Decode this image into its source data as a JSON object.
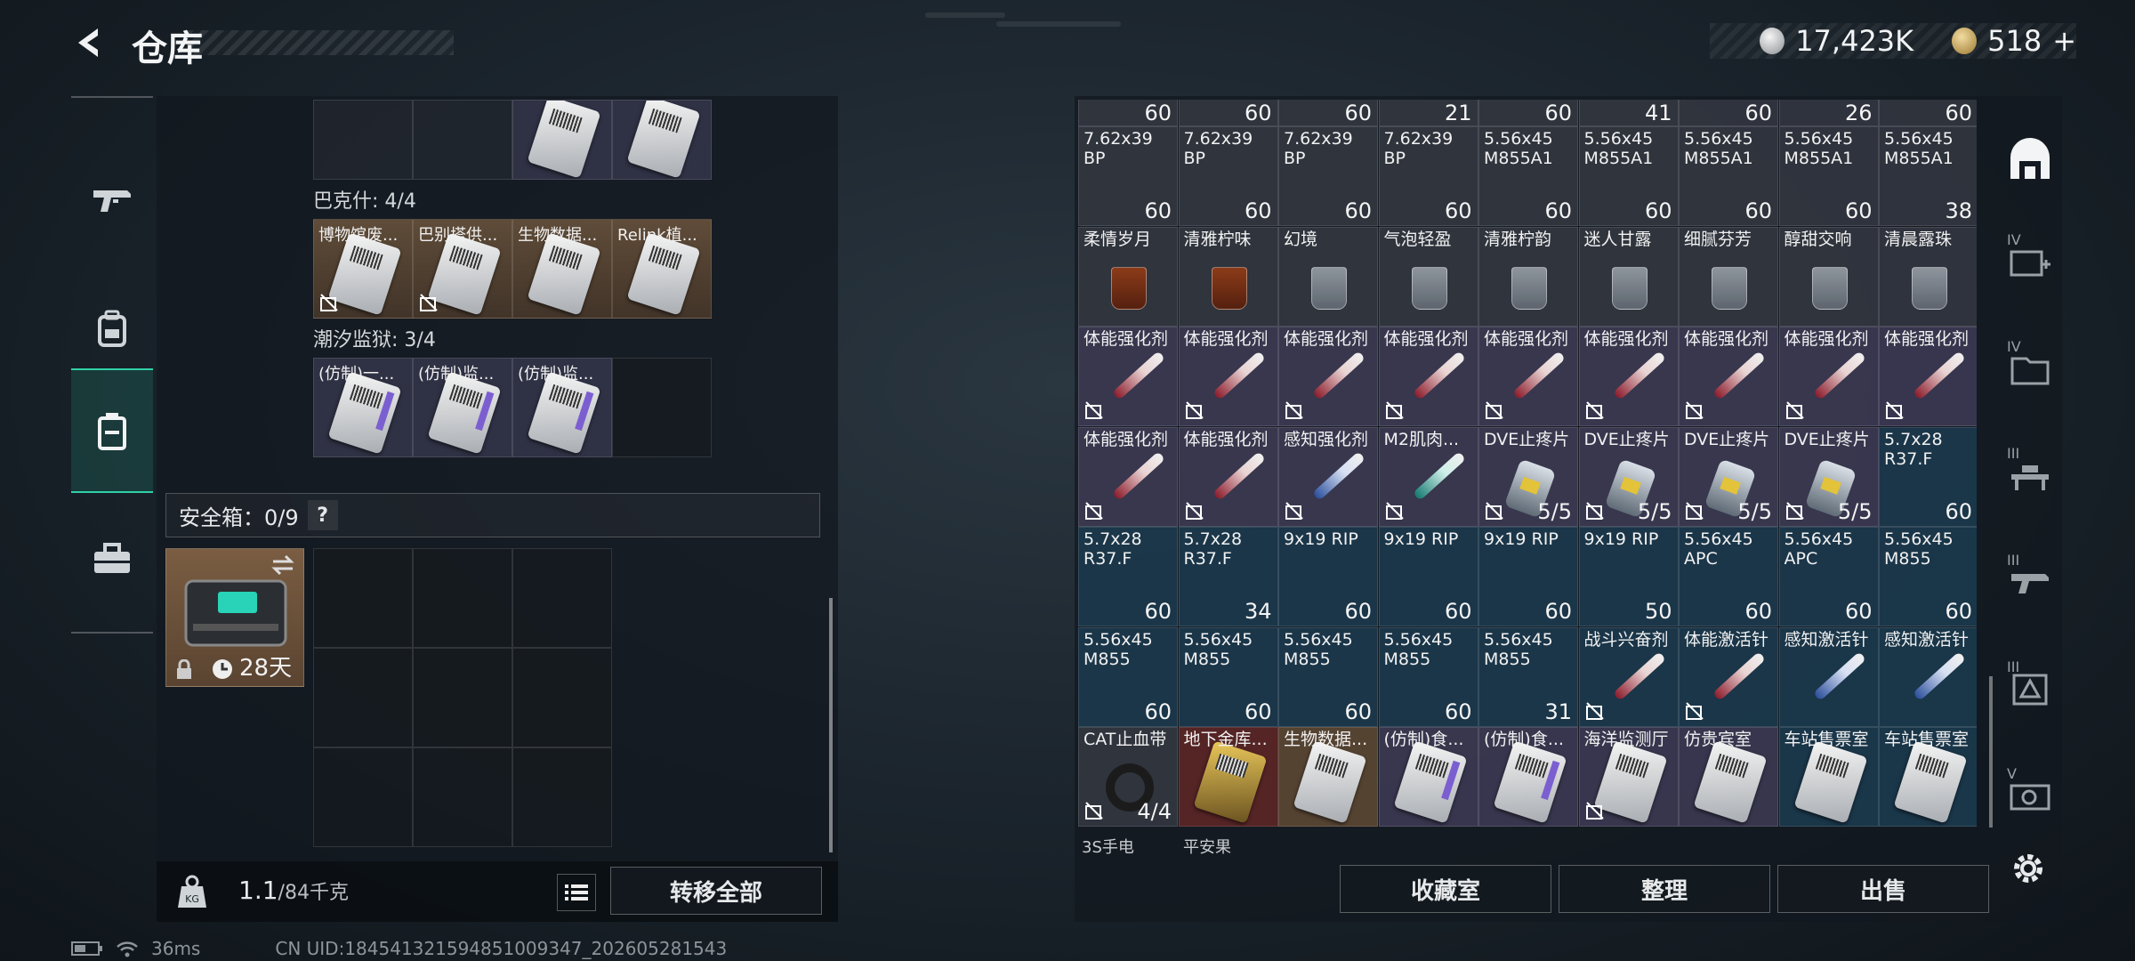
{
  "header": {
    "title": "仓库"
  },
  "currency": [
    {
      "icon": "silver-coin-icon",
      "value": "17,423K"
    },
    {
      "icon": "gold-coin-icon",
      "value": "518",
      "add": "+"
    }
  ],
  "left_nav": [
    {
      "icon": "gun-icon"
    },
    {
      "icon": "backpack-icon"
    },
    {
      "icon": "container-icon",
      "active": true
    },
    {
      "icon": "toolbox-icon"
    }
  ],
  "sections": [
    {
      "label": "巴克什: 4/4",
      "items": [
        "博物馆废...",
        "巴别塔供...",
        "生物数据...",
        "Relink植..."
      ]
    },
    {
      "label": "潮汐监狱: 3/4",
      "items": [
        "(仿制)一...",
        "(仿制)监...",
        "(仿制)监...",
        ""
      ]
    }
  ],
  "safe_box": {
    "label": "安全箱：0/9",
    "help": "?",
    "timer": "28天"
  },
  "weight": {
    "current": "1.1",
    "max": "/84千克"
  },
  "buttons": {
    "transfer_all": "转移全部",
    "collection": "收藏室",
    "organize": "整理",
    "sell": "出售"
  },
  "top_counts": [
    "60",
    "60",
    "60",
    "21",
    "60",
    "41",
    "60",
    "26",
    "60"
  ],
  "inventory_rows": [
    [
      {
        "name": "7.62x39 BP",
        "count": "60",
        "kind": "ammo-tan",
        "bg": "bg-gray"
      },
      {
        "name": "7.62x39 BP",
        "count": "60",
        "kind": "ammo-tan",
        "bg": "bg-gray"
      },
      {
        "name": "7.62x39 BP",
        "count": "60",
        "kind": "ammo-tan",
        "bg": "bg-gray"
      },
      {
        "name": "7.62x39 BP",
        "count": "60",
        "kind": "ammo-tan",
        "bg": "bg-gray"
      },
      {
        "name": "5.56x45 M855A1",
        "count": "60",
        "kind": "ammo-red",
        "bg": "bg-gray"
      },
      {
        "name": "5.56x45 M855A1",
        "count": "60",
        "kind": "ammo-red",
        "bg": "bg-gray"
      },
      {
        "name": "5.56x45 M855A1",
        "count": "60",
        "kind": "ammo-red",
        "bg": "bg-gray"
      },
      {
        "name": "5.56x45 M855A1",
        "count": "60",
        "kind": "ammo-red",
        "bg": "bg-gray"
      },
      {
        "name": "5.56x45 M855A1",
        "count": "38",
        "kind": "ammo-red",
        "bg": "bg-gray"
      }
    ],
    [
      {
        "name": "柔情岁月",
        "count": "",
        "kind": "glass amber",
        "bg": "bg-gray"
      },
      {
        "name": "清雅柠味",
        "count": "",
        "kind": "glass amber",
        "bg": "bg-gray"
      },
      {
        "name": "幻境",
        "count": "",
        "kind": "glass",
        "bg": "bg-gray"
      },
      {
        "name": "气泡轻盈",
        "count": "",
        "kind": "glass",
        "bg": "bg-gray"
      },
      {
        "name": "清雅柠韵",
        "count": "",
        "kind": "glass",
        "bg": "bg-gray"
      },
      {
        "name": "迷人甘露",
        "count": "",
        "kind": "glass",
        "bg": "bg-gray"
      },
      {
        "name": "细腻芬芳",
        "count": "",
        "kind": "glass",
        "bg": "bg-gray"
      },
      {
        "name": "醇甜交响",
        "count": "",
        "kind": "glass",
        "bg": "bg-gray"
      },
      {
        "name": "清晨露珠",
        "count": "",
        "kind": "glass",
        "bg": "bg-gray"
      }
    ],
    [
      {
        "name": "体能强化剂",
        "count": "",
        "kind": "syringe syr-red",
        "bg": "bg-purple",
        "lock": true
      },
      {
        "name": "体能强化剂",
        "count": "",
        "kind": "syringe syr-red",
        "bg": "bg-purple",
        "lock": true
      },
      {
        "name": "体能强化剂",
        "count": "",
        "kind": "syringe syr-red",
        "bg": "bg-purple",
        "lock": true
      },
      {
        "name": "体能强化剂",
        "count": "",
        "kind": "syringe syr-red",
        "bg": "bg-purple",
        "lock": true
      },
      {
        "name": "体能强化剂",
        "count": "",
        "kind": "syringe syr-red",
        "bg": "bg-purple",
        "lock": true
      },
      {
        "name": "体能强化剂",
        "count": "",
        "kind": "syringe syr-red",
        "bg": "bg-purple",
        "lock": true
      },
      {
        "name": "体能强化剂",
        "count": "",
        "kind": "syringe syr-red",
        "bg": "bg-purple",
        "lock": true
      },
      {
        "name": "体能强化剂",
        "count": "",
        "kind": "syringe syr-red",
        "bg": "bg-purple",
        "lock": true
      },
      {
        "name": "体能强化剂",
        "count": "",
        "kind": "syringe syr-red",
        "bg": "bg-purple",
        "lock": true
      }
    ],
    [
      {
        "name": "体能强化剂",
        "count": "",
        "kind": "syringe syr-red",
        "bg": "bg-purple",
        "lock": true
      },
      {
        "name": "体能强化剂",
        "count": "",
        "kind": "syringe syr-red",
        "bg": "bg-purple",
        "lock": true
      },
      {
        "name": "感知强化剂",
        "count": "",
        "kind": "syringe syr-blue",
        "bg": "bg-purple",
        "lock": true
      },
      {
        "name": "M2肌肉...",
        "count": "",
        "kind": "syringe syr-teal",
        "bg": "bg-purple",
        "lock": true
      },
      {
        "name": "DVE止疼片",
        "count": "5/5",
        "kind": "pill",
        "bg": "bg-purple",
        "lock": true
      },
      {
        "name": "DVE止疼片",
        "count": "5/5",
        "kind": "pill",
        "bg": "bg-purple",
        "lock": true
      },
      {
        "name": "DVE止疼片",
        "count": "5/5",
        "kind": "pill",
        "bg": "bg-purple",
        "lock": true
      },
      {
        "name": "DVE止疼片",
        "count": "5/5",
        "kind": "pill",
        "bg": "bg-purple",
        "lock": true
      },
      {
        "name": "5.7x28 R37.F",
        "count": "60",
        "kind": "ammo-tan",
        "bg": "bg-blue"
      }
    ],
    [
      {
        "name": "5.7x28 R37.F",
        "count": "60",
        "kind": "ammo-tan",
        "bg": "bg-blue"
      },
      {
        "name": "5.7x28 R37.F",
        "count": "34",
        "kind": "ammo-tan",
        "bg": "bg-blue"
      },
      {
        "name": "9x19 RIP",
        "count": "60",
        "kind": "ammo-green",
        "bg": "bg-blue"
      },
      {
        "name": "9x19 RIP",
        "count": "60",
        "kind": "ammo-green",
        "bg": "bg-blue"
      },
      {
        "name": "9x19 RIP",
        "count": "60",
        "kind": "ammo-green",
        "bg": "bg-blue"
      },
      {
        "name": "9x19 RIP",
        "count": "50",
        "kind": "ammo-green",
        "bg": "bg-blue"
      },
      {
        "name": "5.56x45 APC",
        "count": "60",
        "kind": "ammo-red",
        "bg": "bg-blue"
      },
      {
        "name": "5.56x45 APC",
        "count": "60",
        "kind": "ammo-red",
        "bg": "bg-blue"
      },
      {
        "name": "5.56x45 M855",
        "count": "60",
        "kind": "ammo-red",
        "bg": "bg-blue"
      }
    ],
    [
      {
        "name": "5.56x45 M855",
        "count": "60",
        "kind": "ammo-red",
        "bg": "bg-blue"
      },
      {
        "name": "5.56x45 M855",
        "count": "60",
        "kind": "ammo-red",
        "bg": "bg-blue"
      },
      {
        "name": "5.56x45 M855",
        "count": "60",
        "kind": "ammo-red",
        "bg": "bg-blue"
      },
      {
        "name": "5.56x45 M855",
        "count": "60",
        "kind": "ammo-red",
        "bg": "bg-blue"
      },
      {
        "name": "5.56x45 M855",
        "count": "31",
        "kind": "ammo-red",
        "bg": "bg-blue"
      },
      {
        "name": "战斗兴奋剂",
        "count": "",
        "kind": "syringe syr-red",
        "bg": "bg-blue",
        "lock": true
      },
      {
        "name": "体能激活针",
        "count": "",
        "kind": "syringe syr-red",
        "bg": "bg-blue",
        "lock": true
      },
      {
        "name": "感知激活针",
        "count": "",
        "kind": "syringe syr-blue",
        "bg": "bg-blue"
      },
      {
        "name": "感知激活针",
        "count": "",
        "kind": "syringe syr-blue",
        "bg": "bg-blue"
      }
    ],
    [
      {
        "name": "CAT止血带",
        "count": "4/4",
        "kind": "tourniquet",
        "bg": "bg-gray",
        "lock": true
      },
      {
        "name": "地下金库...",
        "count": "",
        "kind": "card-gold",
        "bg": "bg-red"
      },
      {
        "name": "生物数据...",
        "count": "",
        "kind": "card",
        "bg": "bg-brown"
      },
      {
        "name": "(仿制)食...",
        "count": "",
        "kind": "card purple",
        "bg": "bg-purple"
      },
      {
        "name": "(仿制)食...",
        "count": "",
        "kind": "card purple",
        "bg": "bg-purple"
      },
      {
        "name": "海洋监测厅",
        "count": "",
        "kind": "card",
        "bg": "bg-purple",
        "lock": true
      },
      {
        "name": "仿贵宾室",
        "count": "",
        "kind": "card",
        "bg": "bg-purple"
      },
      {
        "name": "车站售票室",
        "count": "",
        "kind": "card",
        "bg": "bg-blue"
      },
      {
        "name": "车站售票室",
        "count": "",
        "kind": "card",
        "bg": "bg-blue"
      }
    ]
  ],
  "peek_row": [
    "3S手电",
    "平安果"
  ],
  "right_nav": [
    {
      "icon": "safe-house-icon",
      "label": ""
    },
    {
      "icon": "medical-station-icon",
      "label": "IV"
    },
    {
      "icon": "storage-icon",
      "label": "IV"
    },
    {
      "icon": "workbench-icon",
      "label": "III"
    },
    {
      "icon": "weapon-bench-icon",
      "label": "III"
    },
    {
      "icon": "tech-center-icon",
      "label": "III"
    },
    {
      "icon": "shooting-range-icon",
      "label": "V"
    }
  ],
  "status": {
    "ping": "36ms",
    "uid": "CN UID:18454132159485100934­7_202605281543"
  }
}
